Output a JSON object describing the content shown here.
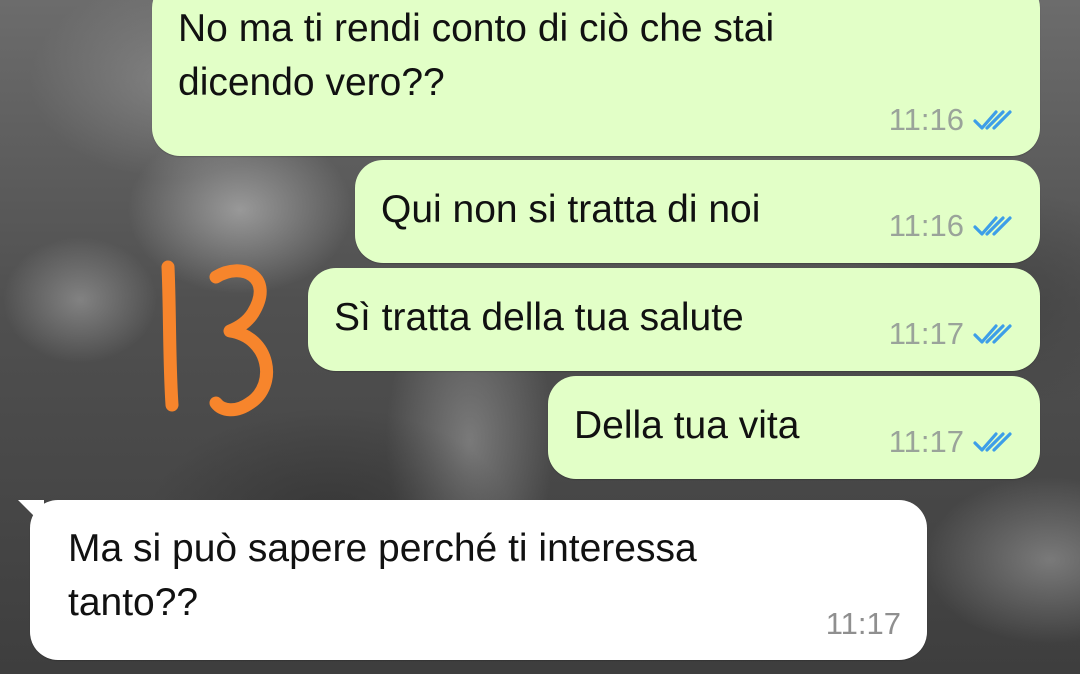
{
  "conversation": {
    "messages": [
      {
        "direction": "outgoing",
        "text": "No ma ti rendi conto di ciò che stai\ndicendo vero??",
        "time": "11:16",
        "status_icon": "double-check-read-icon"
      },
      {
        "direction": "outgoing",
        "text": "Qui non si tratta di noi",
        "time": "11:16",
        "status_icon": "double-check-read-icon"
      },
      {
        "direction": "outgoing",
        "text": "Sì tratta della tua salute",
        "time": "11:17",
        "status_icon": "double-check-read-icon"
      },
      {
        "direction": "outgoing",
        "text": "Della tua vita",
        "time": "11:17",
        "status_icon": "double-check-read-icon"
      },
      {
        "direction": "incoming",
        "text": "Ma si può sapere perché ti interessa\ntanto??",
        "time": "11:17"
      }
    ]
  },
  "annotation": {
    "text": "13",
    "color": "#f7852c",
    "kind": "handwritten"
  },
  "colors": {
    "outgoing_bubble": "#e2ffc7",
    "incoming_bubble": "#ffffff",
    "read_check": "#3d9ee8",
    "timestamp": "#9aa39a"
  }
}
